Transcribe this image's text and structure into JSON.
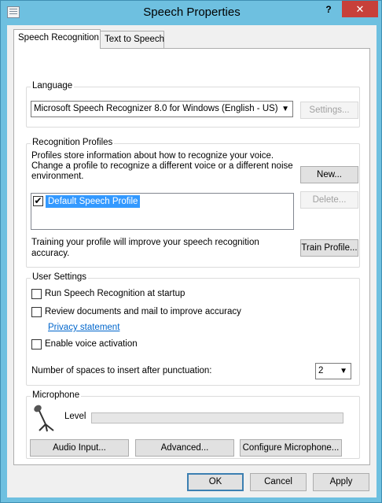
{
  "window": {
    "title": "Speech Properties",
    "help_label": "?",
    "close_label": "✕"
  },
  "tabs": [
    {
      "label": "Speech Recognition",
      "active": true
    },
    {
      "label": "Text to Speech",
      "active": false
    }
  ],
  "language": {
    "group_label": "Language",
    "recognizer_value": "Microsoft Speech Recognizer 8.0 for Windows (English - US)",
    "settings_label": "Settings..."
  },
  "profiles": {
    "group_label": "Recognition Profiles",
    "description_line1": "Profiles store information about how to recognize your voice.",
    "description_line2": "Change a profile to recognize a different voice or a different noise",
    "description_line3": "environment.",
    "new_label": "New...",
    "delete_label": "Delete...",
    "items": [
      {
        "label": "Default Speech Profile",
        "checked": true,
        "selected": true
      }
    ],
    "training_line1": "Training your profile will improve your speech recognition",
    "training_line2": "accuracy.",
    "train_label": "Train Profile..."
  },
  "user_settings": {
    "group_label": "User Settings",
    "run_at_startup": {
      "label": "Run Speech Recognition at startup",
      "checked": false
    },
    "review_documents": {
      "label": "Review documents and mail to improve accuracy",
      "checked": false
    },
    "privacy_link": "Privacy statement",
    "voice_activation": {
      "label": "Enable voice activation",
      "checked": false
    },
    "spaces_label": "Number of spaces to insert after punctuation:",
    "spaces_value": "2"
  },
  "microphone": {
    "group_label": "Microphone",
    "level_label": "Level",
    "level_value": 0,
    "audio_input_label": "Audio Input...",
    "advanced_label": "Advanced...",
    "configure_label": "Configure Microphone..."
  },
  "footer": {
    "ok_label": "OK",
    "cancel_label": "Cancel",
    "apply_label": "Apply"
  },
  "colors": {
    "titlebar": "#6ec0e0",
    "close_button": "#c7403a",
    "selection": "#3399ff",
    "link": "#0066cc"
  }
}
